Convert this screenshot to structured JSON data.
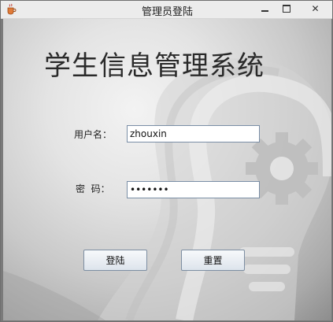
{
  "window": {
    "title": "管理员登陆",
    "app_icon": "java-coffee-icon",
    "controls": [
      "minimize-icon",
      "maximize-icon",
      "close-icon"
    ],
    "close_glyph": "✕"
  },
  "main": {
    "system_title": "学生信息管理系统",
    "username_label": "用户名：",
    "username_value": "zhouxin",
    "password_label": "密  码：",
    "password_value": "•••••••",
    "login_button": "登陆",
    "reset_button": "重置",
    "background_art": "lightbulb-gear-icon"
  }
}
